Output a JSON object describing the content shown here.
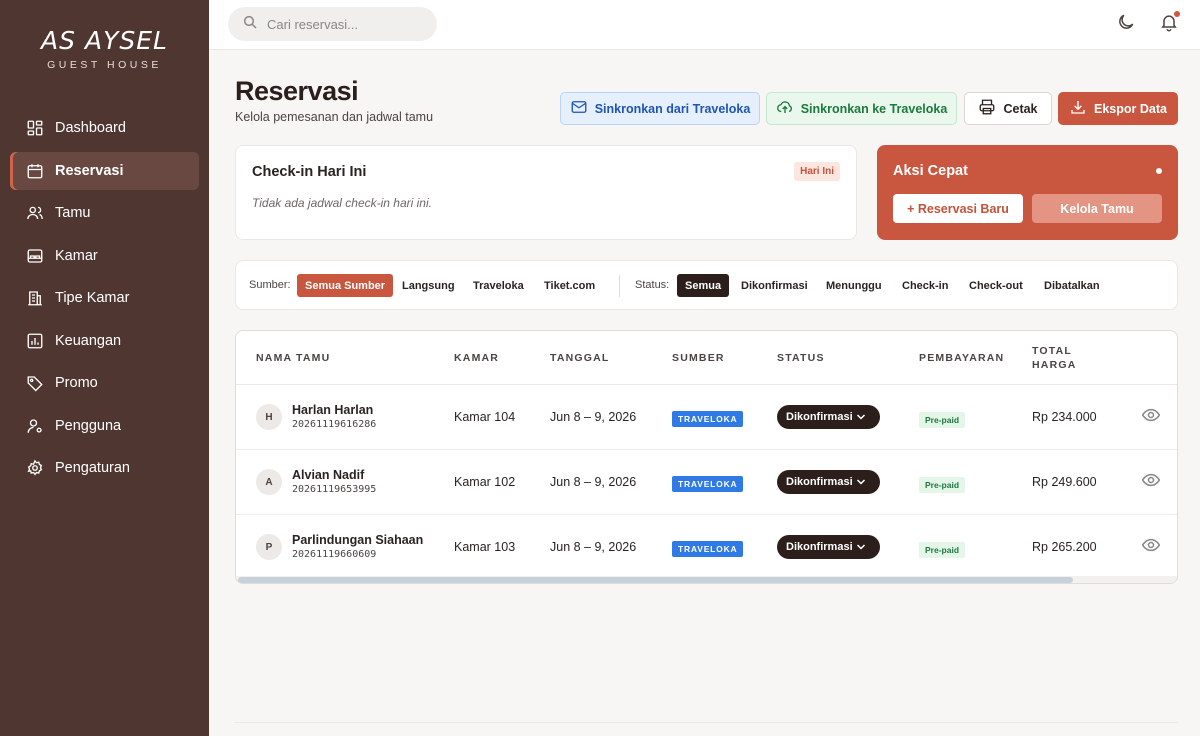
{
  "brand": {
    "name": "AS AYSEL",
    "subtitle": "GUEST HOUSE"
  },
  "sidebar": {
    "items": [
      {
        "label": "Dashboard",
        "icon": "dashboard-icon",
        "active": false
      },
      {
        "label": "Reservasi",
        "icon": "calendar-icon",
        "active": true
      },
      {
        "label": "Tamu",
        "icon": "users-icon",
        "active": false
      },
      {
        "label": "Kamar",
        "icon": "bed-icon",
        "active": false
      },
      {
        "label": "Tipe Kamar",
        "icon": "building-icon",
        "active": false
      },
      {
        "label": "Keuangan",
        "icon": "chart-icon",
        "active": false
      },
      {
        "label": "Promo",
        "icon": "tag-icon",
        "active": false
      },
      {
        "label": "Pengguna",
        "icon": "user-cog-icon",
        "active": false
      },
      {
        "label": "Pengaturan",
        "icon": "gear-icon",
        "active": false
      }
    ]
  },
  "topbar": {
    "search_placeholder": "Cari reservasi...",
    "theme_icon": "moon-icon",
    "notif_icon": "bell-icon"
  },
  "header": {
    "title": "Reservasi",
    "subtitle": "Kelola pemesanan dan jadwal tamu",
    "buttons": {
      "sync_from": "Sinkronkan dari Traveloka",
      "sync_to": "Sinkronkan ke Traveloka",
      "print": "Cetak",
      "export": "Ekspor Data"
    }
  },
  "checkin": {
    "title": "Check-in Hari Ini",
    "badge": "Hari Ini",
    "empty": "Tidak ada jadwal check-in hari ini."
  },
  "quick_actions": {
    "title": "Aksi Cepat",
    "new_reservation": "+ Reservasi Baru",
    "manage_guests": "Kelola Tamu"
  },
  "filters": {
    "source_label": "Sumber:",
    "sources": [
      "Semua Sumber",
      "Langsung",
      "Traveloka",
      "Tiket.com"
    ],
    "status_label": "Status:",
    "statuses": [
      "Semua",
      "Dikonfirmasi",
      "Menunggu",
      "Check-in",
      "Check-out",
      "Dibatalkan"
    ]
  },
  "table": {
    "columns": [
      "NAMA TAMU",
      "KAMAR",
      "TANGGAL",
      "SUMBER",
      "STATUS",
      "PEMBAYARAN",
      "TOTAL",
      "HARGA"
    ],
    "rows": [
      {
        "initial": "H",
        "name": "Harlan Harlan",
        "code": "20261119616286",
        "room": "Kamar 104",
        "date": "Jun 8 – 9, 2026",
        "source": "TRAVELOKA",
        "status": "Dikonfirmasi",
        "payment": "Pre-paid",
        "total": "Rp 234.000"
      },
      {
        "initial": "A",
        "name": "Alvian Nadif",
        "code": "20261119653995",
        "room": "Kamar 102",
        "date": "Jun 8 – 9, 2026",
        "source": "TRAVELOKA",
        "status": "Dikonfirmasi",
        "payment": "Pre-paid",
        "total": "Rp 249.600"
      },
      {
        "initial": "P",
        "name": "Parlindungan Siahaan",
        "code": "20261119660609",
        "room": "Kamar 103",
        "date": "Jun 8 – 9, 2026",
        "source": "TRAVELOKA",
        "status": "Dikonfirmasi",
        "payment": "Pre-paid",
        "total": "Rp 265.200"
      }
    ]
  },
  "colors": {
    "sidebar": "#4f3631",
    "accent": "#c9563e",
    "source_badge": "#2f7ae5",
    "status_pill": "#2b1e1b"
  }
}
